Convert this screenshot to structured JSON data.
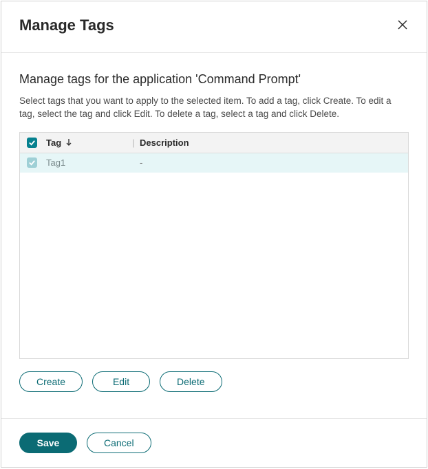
{
  "dialog": {
    "title": "Manage Tags",
    "subtitle": "Manage tags for the application 'Command Prompt'",
    "helptext": "Select tags that you want to apply to the selected item. To add a tag, click Create. To edit a tag, select the tag and click Edit. To delete a tag, select a tag and click Delete."
  },
  "table": {
    "columns": {
      "tag": "Tag",
      "description": "Description",
      "separator": "|"
    },
    "rows": [
      {
        "tag": "Tag1",
        "description": "-",
        "selected": true
      }
    ]
  },
  "buttons": {
    "create": "Create",
    "edit": "Edit",
    "delete": "Delete",
    "save": "Save",
    "cancel": "Cancel"
  }
}
